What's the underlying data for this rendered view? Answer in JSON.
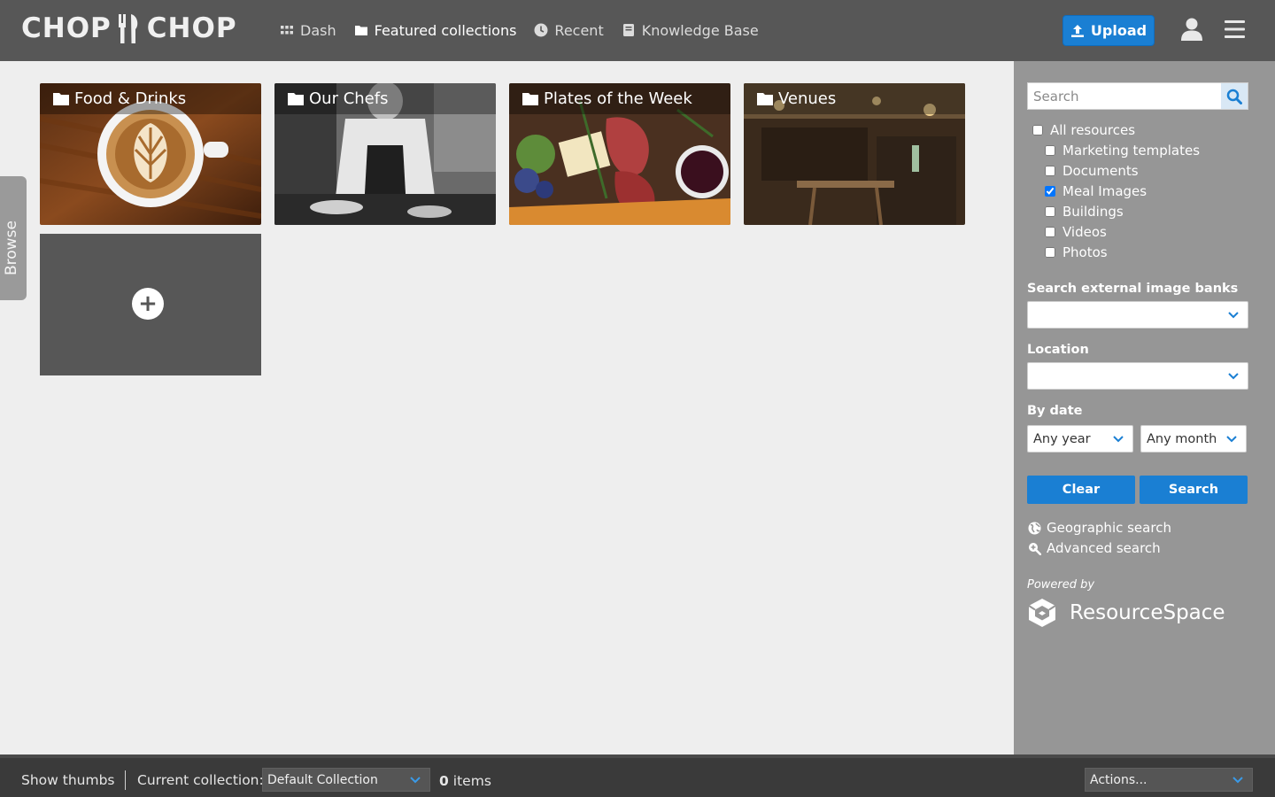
{
  "header": {
    "brand_left": "CHOP",
    "brand_right": "CHOP",
    "nav": [
      {
        "label": "Dash",
        "icon": "grid-icon",
        "active": false
      },
      {
        "label": "Featured collections",
        "icon": "folder-icon",
        "active": true
      },
      {
        "label": "Recent",
        "icon": "clock-icon",
        "active": false
      },
      {
        "label": "Knowledge Base",
        "icon": "book-icon",
        "active": false
      }
    ],
    "upload_label": "Upload"
  },
  "collections": [
    {
      "label": "Food & Drinks"
    },
    {
      "label": "Our Chefs"
    },
    {
      "label": "Plates of the Week"
    },
    {
      "label": "Venues"
    }
  ],
  "add_tile": {
    "symbol": "+"
  },
  "browse_tab": {
    "label": "Browse"
  },
  "sidebar": {
    "search_placeholder": "Search",
    "resource_types": [
      {
        "label": "All resources",
        "checked": false
      },
      {
        "label": "Marketing templates",
        "checked": false
      },
      {
        "label": "Documents",
        "checked": false
      },
      {
        "label": "Meal Images",
        "checked": true
      },
      {
        "label": "Buildings",
        "checked": false
      },
      {
        "label": "Videos",
        "checked": false
      },
      {
        "label": "Photos",
        "checked": false
      }
    ],
    "external_label": "Search external image banks",
    "external_value": "",
    "location_label": "Location",
    "location_value": "",
    "date_label": "By date",
    "year_value": "Any year",
    "month_value": "Any month",
    "clear_label": "Clear",
    "search_label": "Search",
    "geo_link": "Geographic search",
    "advanced_link": "Advanced search",
    "powered_by": "Powered by",
    "rs_brand": "ResourceSpace"
  },
  "footer": {
    "show_thumbs": "Show thumbs",
    "current_collection_label": "Current collection:",
    "collection_value": "Default Collection",
    "item_count": "0",
    "items_label": "items",
    "actions_value": "Actions..."
  },
  "colors": {
    "header_bg": "#575757",
    "accent_blue": "#1a7fd3",
    "sidebar_bg": "#969696",
    "footer_bg": "#3a3a3a"
  }
}
